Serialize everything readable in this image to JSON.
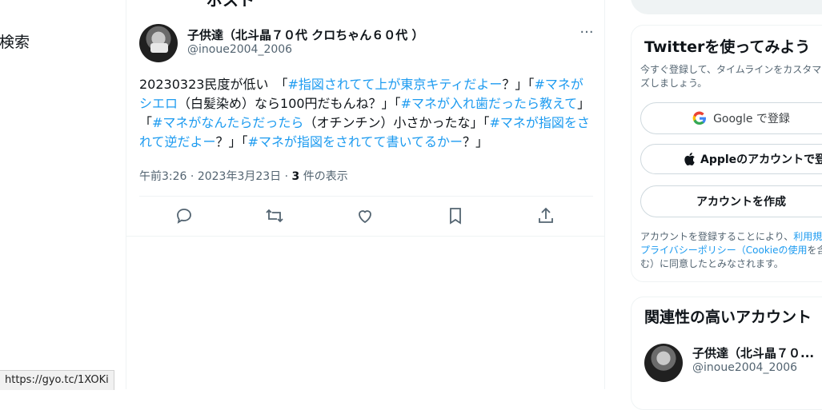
{
  "left_nav": {
    "search_partial": "を検索"
  },
  "main": {
    "header_partial": "ポスト",
    "tweet": {
      "display_name": "子供達（北斗晶７０代 クロちゃん６０代 ）",
      "handle": "@inoue2004_2006",
      "more_label": "···",
      "text_segments": [
        {
          "t": "20230323民度が低い　「",
          "tag": false
        },
        {
          "t": "#指図されてて上が東京キティだよー",
          "tag": true
        },
        {
          "t": "？」「",
          "tag": false
        },
        {
          "t": "#マネがシエロ",
          "tag": true
        },
        {
          "t": "（白髪染め）なら100円だもんね？」「",
          "tag": false
        },
        {
          "t": "#マネが入れ歯だったら教えて",
          "tag": true
        },
        {
          "t": "」「",
          "tag": false
        },
        {
          "t": "#マネがなんたらだったら",
          "tag": true
        },
        {
          "t": "（オチンチン）小さかったな」「",
          "tag": false
        },
        {
          "t": "#マネが指図をされて逆だよー",
          "tag": true
        },
        {
          "t": "？」「",
          "tag": false
        },
        {
          "t": "#マネが指図をされてて書いてるかー",
          "tag": true
        },
        {
          "t": "？」",
          "tag": false
        }
      ],
      "time": "午前3:26",
      "date": "2023年3月23日",
      "views_count": "3",
      "views_label": "件の表示"
    }
  },
  "right": {
    "signup": {
      "title": "Twitterを使ってみよう",
      "subtitle": "今すぐ登録して、タイムラインをカスタマイズしましょう。",
      "google_button": "Google で登録",
      "apple_button": "Appleのアカウントで登録",
      "create_button": "アカウントを作成",
      "terms_prefix": "アカウントを登録することにより、",
      "terms_link": "利用規約",
      "privacy_link": "プライバシーポリシー（Cookieの使用",
      "terms_suffix": "を含む）に同意したとみなされます。"
    },
    "related": {
      "title": "関連性の高いアカウント",
      "name": "子供達（北斗晶７０...",
      "handle": "@inoue2004_2006"
    }
  },
  "status_bar": {
    "url": "https://gyo.tc/1XOKi"
  },
  "colors": {
    "link": "#1d9bf0",
    "muted": "#536471",
    "border": "#eff3f4"
  },
  "icons": [
    "reply-icon",
    "retweet-icon",
    "like-icon",
    "bookmark-icon",
    "share-icon",
    "google-icon",
    "apple-icon"
  ]
}
